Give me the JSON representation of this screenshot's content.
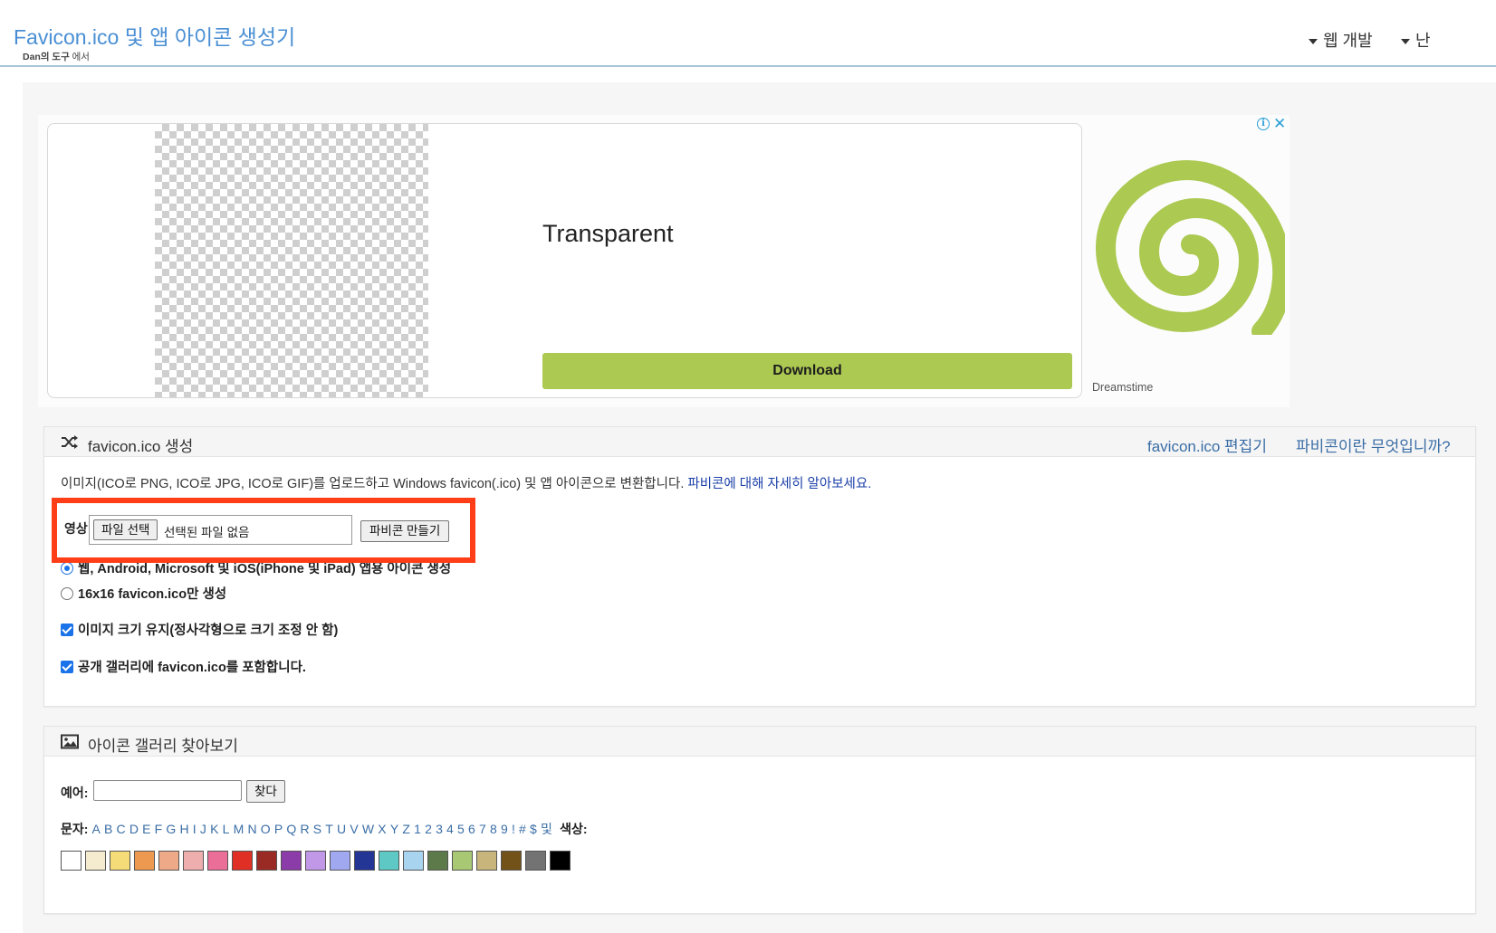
{
  "header": {
    "title": "Favicon.ico 및 앱 아이콘 생성기",
    "subtitle_strong": "Dan의 도구",
    "subtitle_rest": " 에서",
    "nav": [
      {
        "label": "웹 개발"
      },
      {
        "label": "난"
      }
    ]
  },
  "ad": {
    "headline": "Transparent",
    "button": "Download",
    "brand": "Dreamstime",
    "info_icon": "i",
    "close_icon": "✕",
    "accent": "#acc952"
  },
  "generator": {
    "title": "favicon.ico 생성",
    "links": [
      "favicon.ico 편집기",
      "파비콘이란 무엇입니까?"
    ],
    "description": "이미지(ICO로 PNG, ICO로 JPG, ICO로 GIF)를 업로드하고 Windows favicon(.ico) 및 앱 아이콘으로 변환합니다. ",
    "description_link": "파비콘에 대해 자세히 알아보세요.",
    "image_label": "영상:",
    "file_button": "파일 선택",
    "file_status": "선택된 파일 없음",
    "make_button": "파비콘 만들기",
    "options": [
      {
        "type": "radio",
        "checked": true,
        "label": "웹, Android, Microsoft 및 iOS(iPhone 및 iPad) 앱용 아이콘 생성"
      },
      {
        "type": "radio",
        "checked": false,
        "label": "16x16 favicon.ico만 생성"
      },
      {
        "type": "checkbox",
        "checked": true,
        "label": "이미지 크기 유지(정사각형으로 크기 조정 안 함)"
      },
      {
        "type": "checkbox",
        "checked": true,
        "label": "공개 갤러리에 favicon.ico를 포함합니다."
      }
    ]
  },
  "gallery": {
    "title": "아이콘 갤러리 찾아보기",
    "search_label": "예어:",
    "search_value": "",
    "search_button": "찾다",
    "letters_label": "문자:",
    "letters": [
      "A",
      "B",
      "C",
      "D",
      "E",
      "F",
      "G",
      "H",
      "I",
      "J",
      "K",
      "L",
      "M",
      "N",
      "O",
      "P",
      "Q",
      "R",
      "S",
      "T",
      "U",
      "V",
      "W",
      "X",
      "Y",
      "Z",
      "1",
      "2",
      "3",
      "4",
      "5",
      "6",
      "7",
      "8",
      "9",
      "!",
      "#",
      "$"
    ],
    "and_word": "및",
    "colors_label": "색상:",
    "colors": [
      "#ffffff",
      "#f5ecd0",
      "#f5dc78",
      "#ed9a50",
      "#eea989",
      "#eeaeae",
      "#ea6e98",
      "#e02f24",
      "#9a2a24",
      "#8c3ca8",
      "#c197e8",
      "#a0a8f0",
      "#233696",
      "#5ec8c4",
      "#a9d4f0",
      "#5c7a4a",
      "#a8c874",
      "#c7b57c",
      "#735219",
      "#737373",
      "#000000"
    ]
  }
}
